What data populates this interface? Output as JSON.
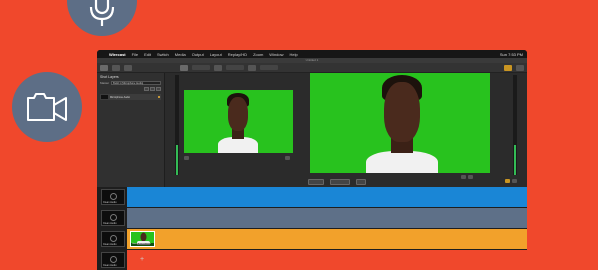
{
  "colors": {
    "background": "#f0482c",
    "icon_circle": "#5d6e86",
    "track_blue": "#1a86d6",
    "track_slate": "#5e7088",
    "track_orange": "#f2a12b",
    "track_red": "#f0482c",
    "chroma_green": "#28c21e"
  },
  "icons": {
    "microphone": "microphone-icon",
    "video_camera": "video-camera-icon"
  },
  "menubar": {
    "app_name": "Wirecast",
    "items": [
      "File",
      "Edit",
      "Switch",
      "Media",
      "Output",
      "Layout",
      "Replay/HD",
      "Zoom",
      "Window",
      "Help"
    ],
    "clock": "Sun 7:53 PM"
  },
  "window": {
    "title": "Untitled 1"
  },
  "left_panel": {
    "title": "Shot Layers",
    "row_label": "Master",
    "select_value": "Build 1 (Microphone Audio)",
    "layer_label": "Microphone Audio"
  },
  "timeline": {
    "tracks": [
      {
        "label": "Clean Audio",
        "color": "#1a86d6",
        "has_clip": false
      },
      {
        "label": "Clean Audio",
        "color": "#5e7088",
        "has_clip": false
      },
      {
        "label": "Clean Audio",
        "color": "#f2a12b",
        "has_clip": true,
        "clip_label": "Green Screen Pres"
      },
      {
        "label": "Clean Audio",
        "color": "#f0482c",
        "has_clip": false,
        "show_plus": true
      }
    ]
  },
  "center_buttons": [
    "Cut",
    "Smooth",
    "Go"
  ]
}
